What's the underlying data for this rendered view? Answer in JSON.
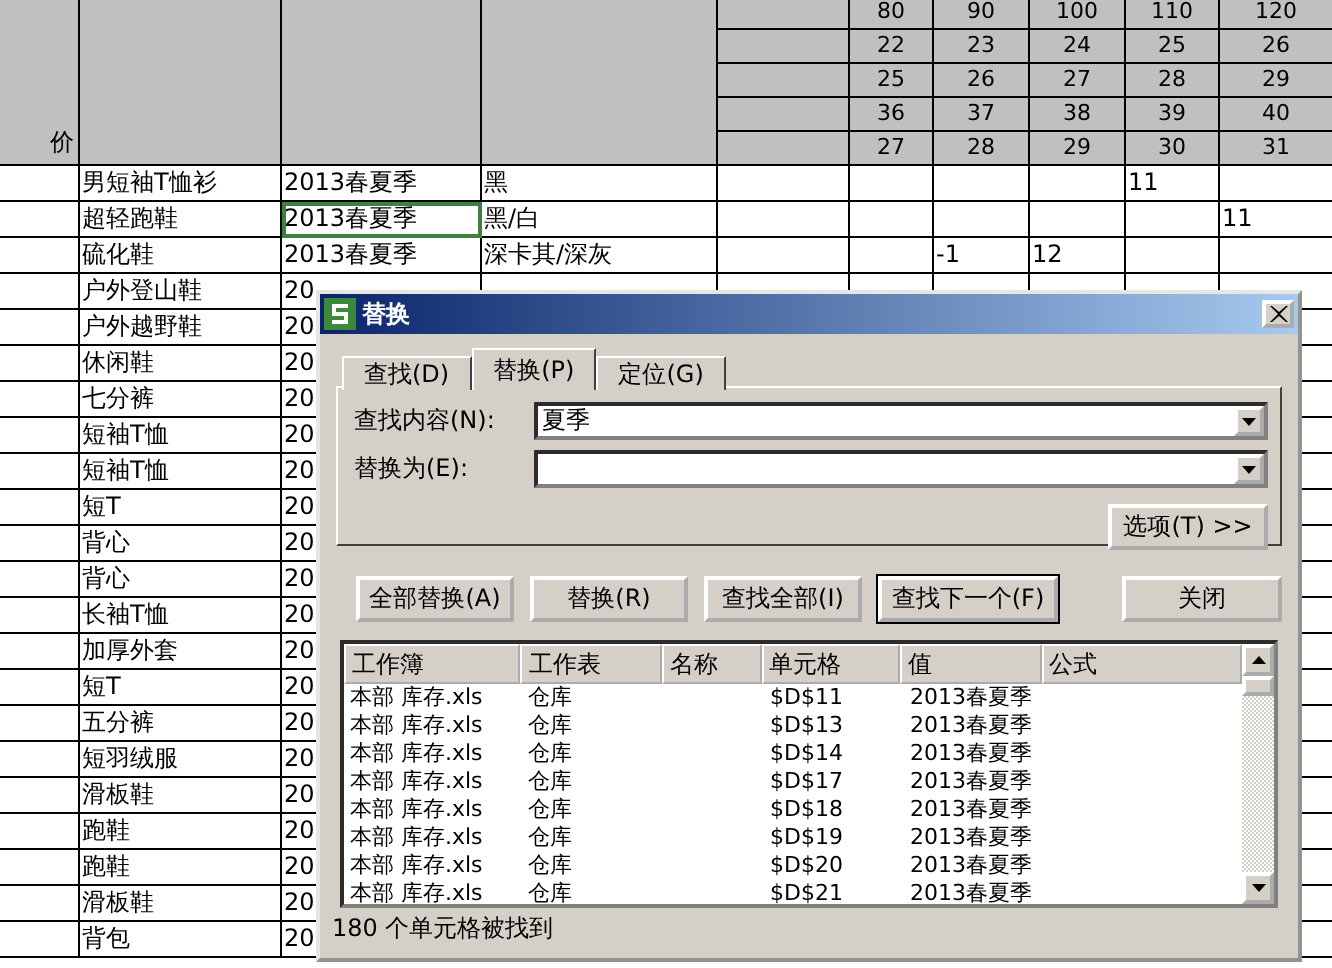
{
  "sheet": {
    "header_label": "价",
    "size_rows": [
      [
        "80",
        "90",
        "100",
        "110",
        "120"
      ],
      [
        "22",
        "23",
        "24",
        "25",
        "26"
      ],
      [
        "25",
        "26",
        "27",
        "28",
        "29"
      ],
      [
        "36",
        "37",
        "38",
        "39",
        "40"
      ],
      [
        "27",
        "28",
        "29",
        "30",
        "31"
      ]
    ],
    "rows": [
      {
        "product": "男短袖T恤衫",
        "season": "2013春夏季",
        "variant": "黑",
        "column_9": "11",
        "selected": false
      },
      {
        "product": "超轻跑鞋",
        "season": "2013春夏季",
        "variant": "黑/白",
        "column_10": "11",
        "selected": true
      },
      {
        "product": "硫化鞋",
        "season": "2013春夏季",
        "variant": "深卡其/深灰",
        "column_7": "-1",
        "column_8": "12",
        "selected": false
      },
      {
        "product": "户外登山鞋",
        "season": "20",
        "selected": false
      },
      {
        "product": "户外越野鞋",
        "season": "20",
        "selected": false
      },
      {
        "product": "休闲鞋",
        "season": "20",
        "selected": false
      },
      {
        "product": "七分裤",
        "season": "20",
        "selected": false
      },
      {
        "product": "短袖T恤",
        "season": "20",
        "selected": false
      },
      {
        "product": "短袖T恤",
        "season": "20",
        "selected": false
      },
      {
        "product": "短T",
        "season": "20",
        "selected": false
      },
      {
        "product": "背心",
        "season": "20",
        "selected": false
      },
      {
        "product": "背心",
        "season": "20",
        "selected": false
      },
      {
        "product": "长袖T恤",
        "season": "20",
        "selected": false
      },
      {
        "product": "加厚外套",
        "season": "20",
        "selected": false
      },
      {
        "product": "短T",
        "season": "20",
        "selected": false
      },
      {
        "product": "五分裤",
        "season": "20",
        "selected": false
      },
      {
        "product": "短羽绒服",
        "season": "20",
        "selected": false
      },
      {
        "product": "滑板鞋",
        "season": "20",
        "selected": false
      },
      {
        "product": "跑鞋",
        "season": "20",
        "selected": false
      },
      {
        "product": "跑鞋",
        "season": "20",
        "selected": false
      },
      {
        "product": "滑板鞋",
        "season": "20",
        "selected": false
      },
      {
        "product": "背包",
        "season": "20",
        "selected": false
      }
    ]
  },
  "dialog": {
    "title": "替换",
    "tabs": [
      {
        "label": "查找(D)",
        "selected": false
      },
      {
        "label": "替换(P)",
        "selected": true
      },
      {
        "label": "定位(G)",
        "selected": false
      }
    ],
    "fields": [
      {
        "label": "查找内容(N):",
        "value": "夏季"
      },
      {
        "label": "替换为(E):"
      }
    ],
    "options_button": "选项(T) >>",
    "buttons": [
      {
        "label": "全部替换(A)",
        "default": false
      },
      {
        "label": "替换(R)",
        "default": false
      },
      {
        "label": "查找全部(I)",
        "default": false
      },
      {
        "label": "查找下一个(F)",
        "default": true
      },
      {
        "label": "关闭",
        "default": false
      }
    ],
    "results": {
      "columns": [
        "工作簿",
        "工作表",
        "名称",
        "单元格",
        "值",
        "公式"
      ],
      "rows": [
        {
          "workbook": "本部 库存.xls",
          "sheet": "仓库",
          "cell": "$D$11",
          "value": "2013春夏季"
        },
        {
          "workbook": "本部 库存.xls",
          "sheet": "仓库",
          "cell": "$D$13",
          "value": "2013春夏季"
        },
        {
          "workbook": "本部 库存.xls",
          "sheet": "仓库",
          "cell": "$D$14",
          "value": "2013春夏季"
        },
        {
          "workbook": "本部 库存.xls",
          "sheet": "仓库",
          "cell": "$D$17",
          "value": "2013春夏季"
        },
        {
          "workbook": "本部 库存.xls",
          "sheet": "仓库",
          "cell": "$D$18",
          "value": "2013春夏季"
        },
        {
          "workbook": "本部 库存.xls",
          "sheet": "仓库",
          "cell": "$D$19",
          "value": "2013春夏季"
        },
        {
          "workbook": "本部 库存.xls",
          "sheet": "仓库",
          "cell": "$D$20",
          "value": "2013春夏季"
        },
        {
          "workbook": "本部 库存.xls",
          "sheet": "仓库",
          "cell": "$D$21",
          "value": "2013春夏季"
        }
      ]
    },
    "status": "180 个单元格被找到"
  }
}
